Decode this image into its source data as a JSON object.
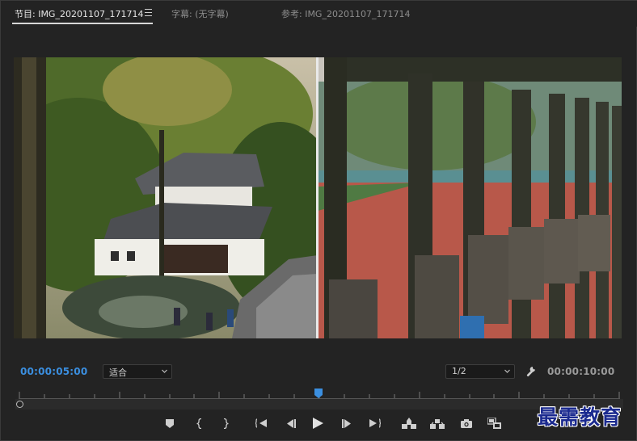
{
  "tabs": [
    {
      "label": "节目: IMG_20201107_171714",
      "active": true
    },
    {
      "label": "字幕: (无字幕)",
      "active": false
    },
    {
      "label": "参考: IMG_20201107_171714",
      "active": false
    }
  ],
  "timecode": {
    "current": "00:00:05:00",
    "duration": "00:00:10:00"
  },
  "fit_select": {
    "value": "适合"
  },
  "resolution_select": {
    "value": "1/2"
  },
  "playhead": {
    "position_fraction": 0.5
  },
  "transport": [
    {
      "name": "add-marker-icon"
    },
    {
      "name": "mark-in-icon"
    },
    {
      "name": "mark-out-icon"
    },
    {
      "name": "go-to-in-icon"
    },
    {
      "name": "step-back-icon"
    },
    {
      "name": "play-icon"
    },
    {
      "name": "step-forward-icon"
    },
    {
      "name": "go-to-out-icon"
    },
    {
      "name": "lift-icon"
    },
    {
      "name": "extract-icon"
    },
    {
      "name": "export-frame-icon"
    },
    {
      "name": "compare-view-icon"
    }
  ],
  "watermark": "最需教育",
  "colors": {
    "accent": "#3b8fe0",
    "background": "#232323"
  }
}
